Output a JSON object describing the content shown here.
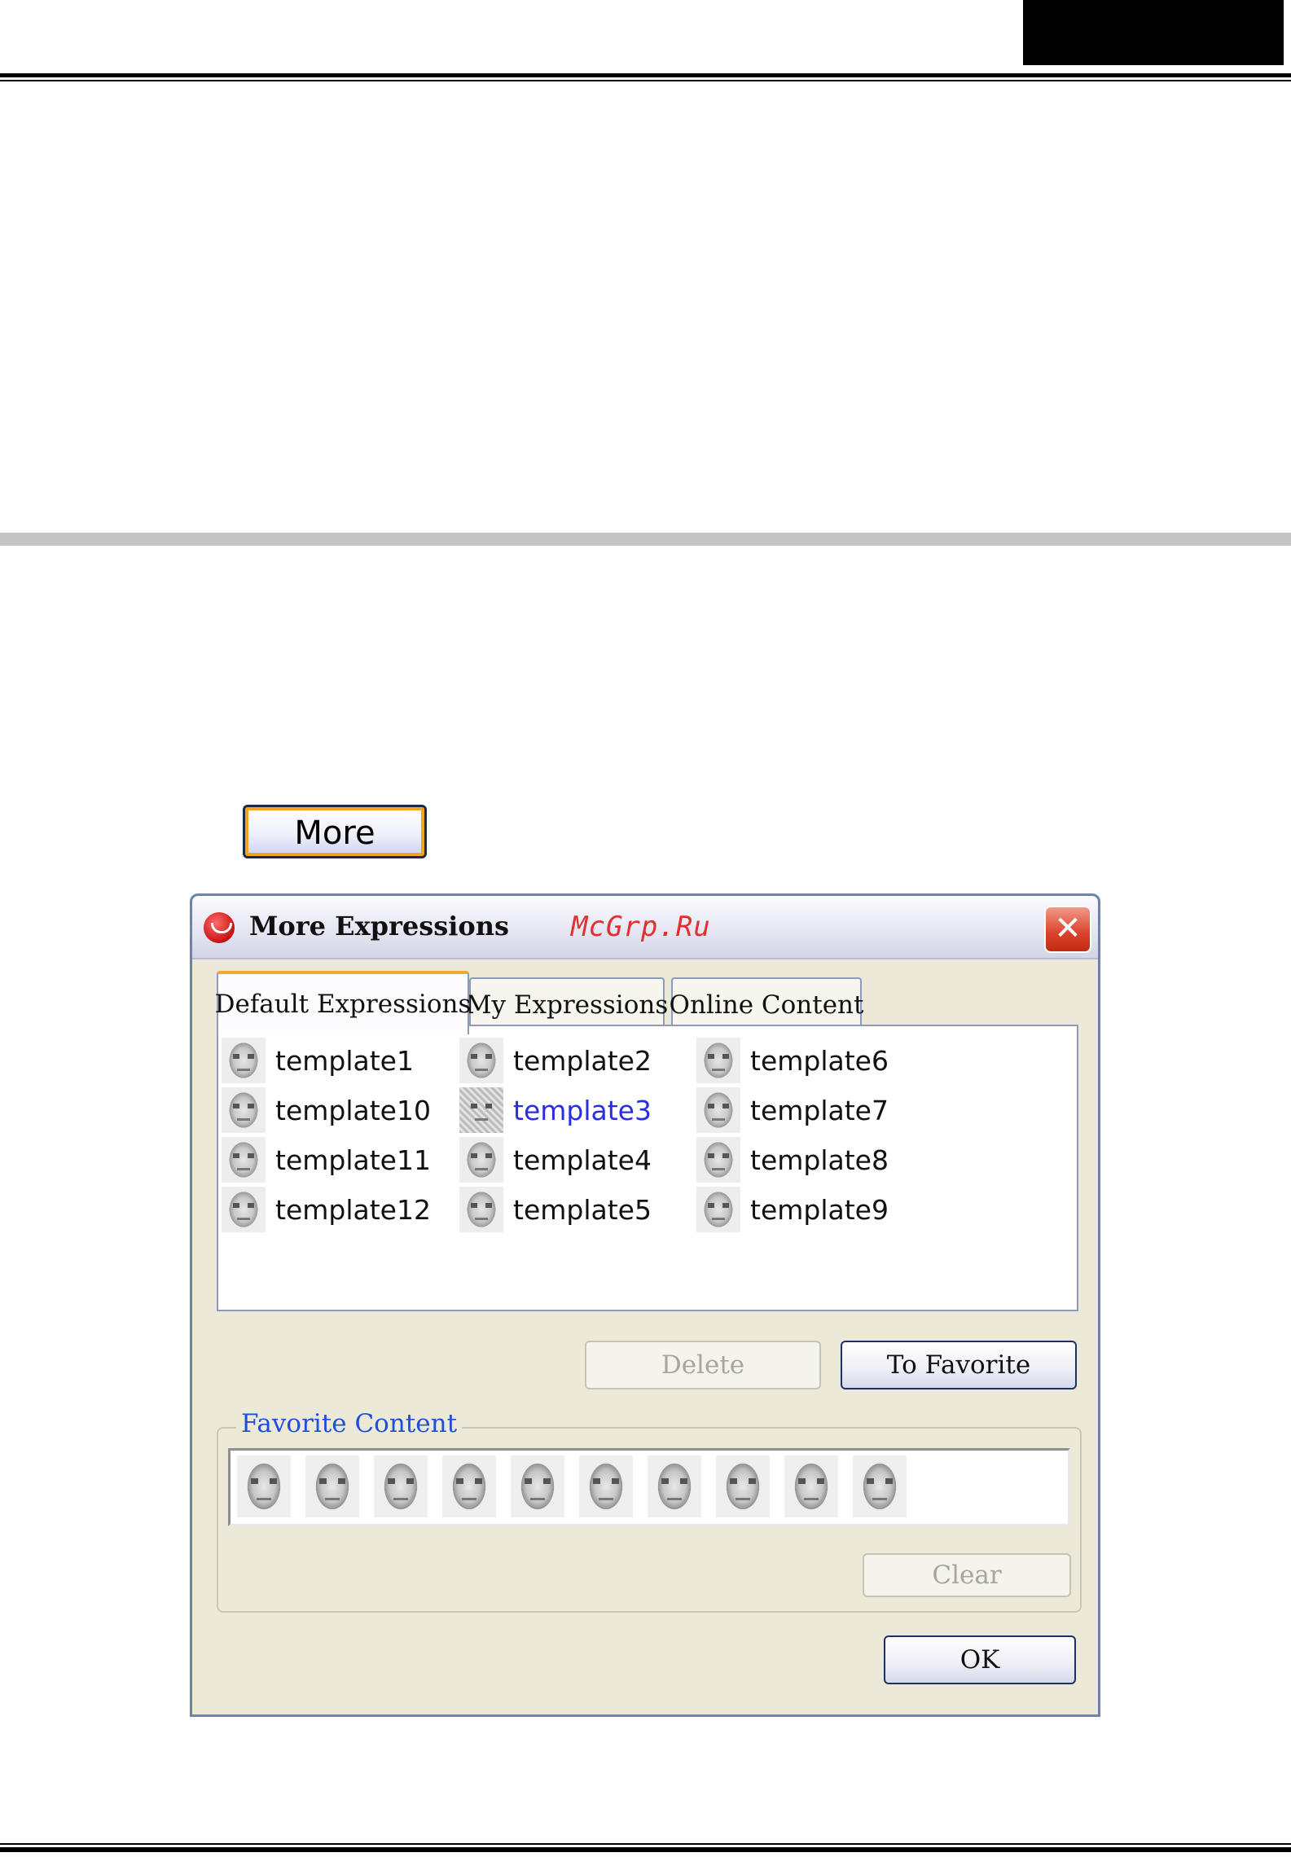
{
  "more_button": {
    "label": "More"
  },
  "dialog": {
    "title": "More Expressions",
    "watermark": "McGrp.Ru",
    "close_symbol": "✕",
    "tabs": [
      {
        "label": "Default Expressions",
        "active": true
      },
      {
        "label": "My Expressions",
        "active": false
      },
      {
        "label": "Online Content",
        "active": false
      }
    ],
    "templates": {
      "col1": [
        "template1",
        "template10",
        "template11",
        "template12"
      ],
      "col2": [
        "template2",
        "template3",
        "template4",
        "template5"
      ],
      "col3": [
        "template6",
        "template7",
        "template8",
        "template9"
      ],
      "highlighted": "template3",
      "icon": "face-thumbnail-icon"
    },
    "buttons": {
      "delete": "Delete",
      "to_favorite": "To Favorite",
      "clear": "Clear",
      "ok": "OK"
    },
    "favorite": {
      "legend": "Favorite Content",
      "item_count": 10
    }
  },
  "colors": {
    "legend_blue": "#1d4fd8",
    "highlight_text": "#2a2ee0",
    "watermark_red": "#e03030",
    "button_accent": "#f3a41f"
  }
}
